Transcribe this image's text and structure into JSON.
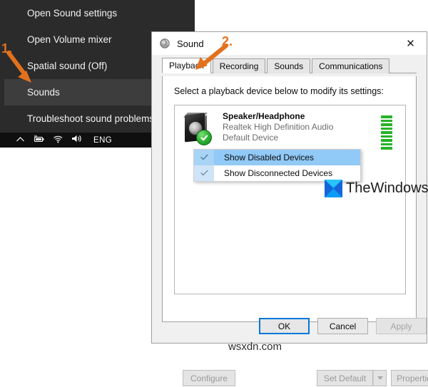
{
  "flyout": {
    "items": [
      {
        "label": "Open Sound settings",
        "highlighted": false
      },
      {
        "label": "Open Volume mixer",
        "highlighted": false
      },
      {
        "label": "Spatial sound (Off)",
        "highlighted": false
      },
      {
        "label": "Sounds",
        "highlighted": true
      },
      {
        "label": "Troubleshoot sound problems",
        "highlighted": false
      }
    ]
  },
  "taskbar": {
    "icons": [
      "chevron-up-icon",
      "battery-icon",
      "wifi-icon",
      "speaker-icon"
    ],
    "language": "ENG"
  },
  "dialog": {
    "title": "Sound",
    "close_label": "✕",
    "tabs": [
      {
        "label": "Playback",
        "active": true
      },
      {
        "label": "Recording",
        "active": false
      },
      {
        "label": "Sounds",
        "active": false
      },
      {
        "label": "Communications",
        "active": false
      }
    ],
    "panel_label": "Select a playback device below to modify its settings:",
    "device": {
      "name": "Speaker/Headphone",
      "driver": "Realtek High Definition Audio",
      "status": "Default Device",
      "meter_bars_total": 9,
      "meter_bars_active": 9,
      "meter_color": "#27b327"
    },
    "context_menu": [
      {
        "label": "Show Disabled Devices",
        "checked": true,
        "selected": true
      },
      {
        "label": "Show Disconnected Devices",
        "checked": true,
        "selected": false
      }
    ],
    "buttons": {
      "configure": "Configure",
      "set_default": "Set Default",
      "properties": "Properties",
      "ok": "OK",
      "cancel": "Cancel",
      "apply": "Apply"
    }
  },
  "annotations": [
    {
      "number": "1.",
      "target": "sounds-menu-item",
      "color": "#e2711d"
    },
    {
      "number": "2.",
      "target": "playback-tab",
      "color": "#e2711d"
    }
  ],
  "watermarks": {
    "primary": "TheWindowsClub",
    "secondary": "wsxdn.com"
  },
  "colors": {
    "accent_orange": "#e2711d",
    "flyout_bg": "#2b2b2b",
    "flyout_highlight": "#3d3d3d",
    "taskbar_bg": "#0f0f0f",
    "dialog_bg": "#f0f0f0",
    "selection_blue": "#91c9f7",
    "focus_blue": "#0078d7"
  }
}
